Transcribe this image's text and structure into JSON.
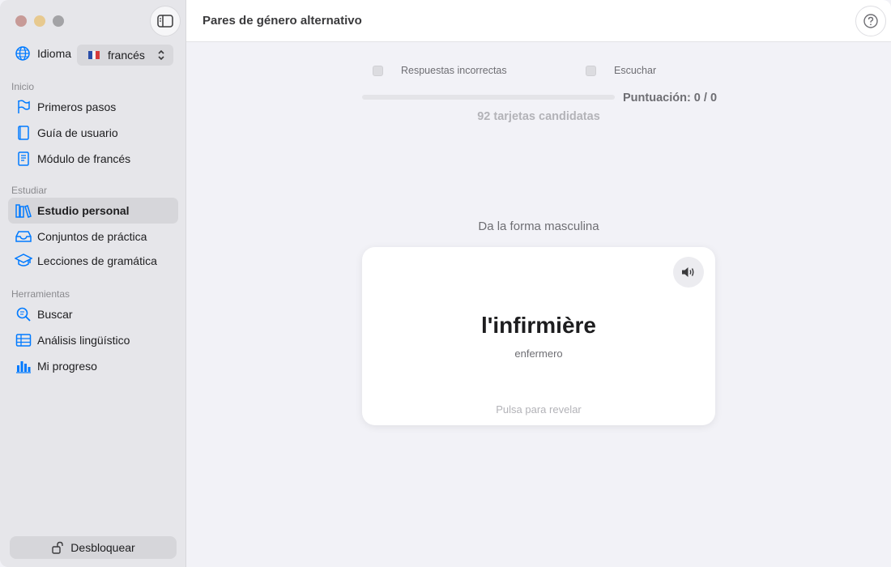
{
  "sidebar": {
    "language_label": "Idioma",
    "language_value": "francés",
    "sections": [
      {
        "title": "Inicio",
        "items": [
          {
            "label": "Primeros pasos",
            "icon": "flag-icon"
          },
          {
            "label": "Guía de usuario",
            "icon": "book-icon"
          },
          {
            "label": "Módulo de francés",
            "icon": "module-book-icon"
          }
        ]
      },
      {
        "title": "Estudiar",
        "items": [
          {
            "label": "Estudio personal",
            "icon": "library-icon",
            "active": true
          },
          {
            "label": "Conjuntos de práctica",
            "icon": "tray-icon"
          },
          {
            "label": "Lecciones de gramática",
            "icon": "graduation-cap-icon"
          }
        ]
      },
      {
        "title": "Herramientas",
        "items": [
          {
            "label": "Buscar",
            "icon": "search-icon"
          },
          {
            "label": "Análisis lingüístico",
            "icon": "table-icon"
          },
          {
            "label": "Mi progreso",
            "icon": "bar-chart-icon"
          }
        ]
      }
    ],
    "unlock_label": "Desbloquear"
  },
  "header": {
    "title": "Pares de género alternativo"
  },
  "main": {
    "option_incorrect": "Respuestas incorrectas",
    "option_listen": "Escuchar",
    "progress_fraction": 0,
    "score": "Puntuación: 0 / 0",
    "candidates": "92 tarjetas candidatas",
    "prompt": "Da la forma masculina",
    "card": {
      "word": "l'infirmière",
      "translation": "enfermero",
      "reveal_hint": "Pulsa para revelar"
    }
  },
  "colors": {
    "accent": "#007aff",
    "sidebar_bg": "#e6e6ea",
    "main_bg": "#f2f2f7"
  }
}
